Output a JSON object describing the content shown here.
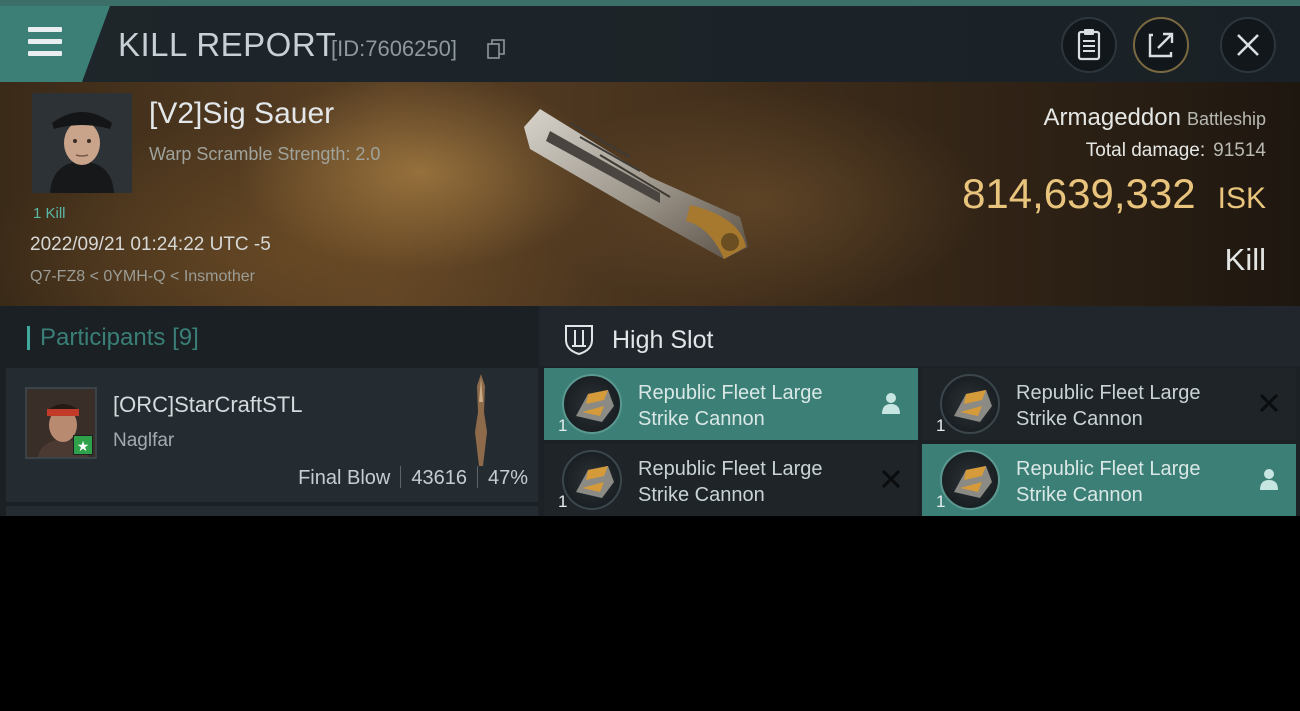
{
  "header": {
    "title": "KILL REPORT",
    "report_id": "[ID:7606250]",
    "icons": [
      "menu-icon",
      "copy-icon",
      "clipboard-icon",
      "share-icon",
      "close-icon"
    ]
  },
  "victim": {
    "name": "[V2]Sig Sauer",
    "warp_scramble": "Warp Scramble Strength: 2.0",
    "kill_count": "1 Kill",
    "datetime": "2022/09/21 01:24:22 UTC -5",
    "location": "Q7-FZ8 < 0YMH-Q < Insmother"
  },
  "ship": {
    "name": "Armageddon",
    "class": "Battleship",
    "total_damage_label": "Total damage:",
    "total_damage_value": "91514",
    "isk_value": "814,639,332",
    "isk_unit": "ISK",
    "type": "Kill"
  },
  "participants": {
    "title": "Participants",
    "count": "[9]",
    "rows": [
      {
        "name": "[ORC]StarCraftSTL",
        "ship": "Naglfar",
        "final_blow": "Final Blow",
        "damage": "43616",
        "percent": "47%"
      }
    ]
  },
  "high_slot": {
    "title": "High Slot",
    "items": [
      {
        "name": "Republic Fleet Large Strike Cannon",
        "qty": "1",
        "status": "person-icon",
        "highlight": true
      },
      {
        "name": "Republic Fleet Large Strike Cannon",
        "qty": "1",
        "status": "destroyed-icon",
        "highlight": false
      },
      {
        "name": "Republic Fleet Large Strike Cannon",
        "qty": "1",
        "status": "destroyed-icon",
        "highlight": false
      },
      {
        "name": "Republic Fleet Large Strike Cannon",
        "qty": "1",
        "status": "person-icon",
        "highlight": true
      }
    ]
  },
  "colors": {
    "accent_teal": "#3c7f77",
    "isk_gold": "#e9c47d",
    "kill_green": "#59b9a7"
  }
}
